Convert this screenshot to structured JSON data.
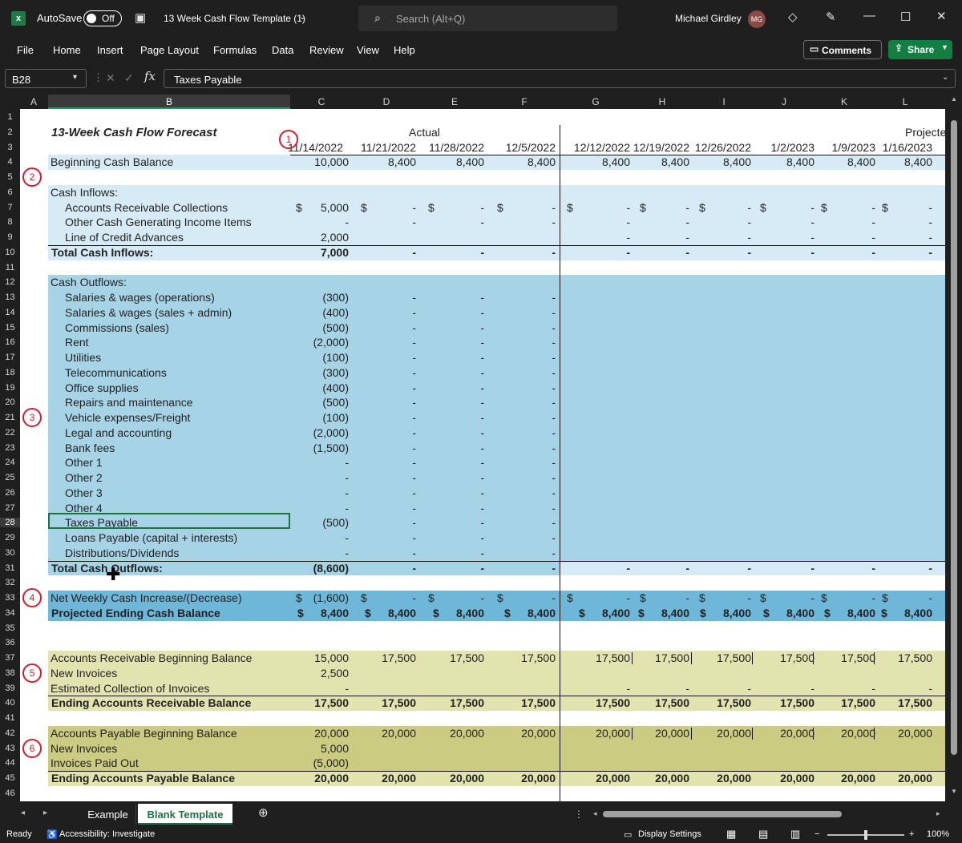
{
  "window": {
    "autosave_label": "AutoSave",
    "autosave_state": "Off",
    "file_title": "13 Week Cash Flow Template (1)",
    "search_placeholder": "Search (Alt+Q)",
    "user_name": "Michael Girdley",
    "user_initials": "MG"
  },
  "ribbon": {
    "menus": [
      "File",
      "Home",
      "Insert",
      "Page Layout",
      "Formulas",
      "Data",
      "Review",
      "View",
      "Help"
    ],
    "comments_label": "Comments",
    "share_label": "Share"
  },
  "formula_bar": {
    "name_box": "B28",
    "formula": "Taxes Payable"
  },
  "columns": [
    "A",
    "B",
    "C",
    "D",
    "E",
    "F",
    "G",
    "H",
    "I",
    "J",
    "K",
    "L"
  ],
  "sheet": {
    "title": "13-Week  Cash Flow Forecast",
    "actual_label": "Actual",
    "projected_label": "Projecte",
    "dates": [
      "11/14/2022",
      "11/21/2022",
      "11/28/2022",
      "12/5/2022",
      "12/12/2022",
      "12/19/2022",
      "12/26/2022",
      "1/2/2023",
      "1/9/2023",
      "1/16/2023"
    ],
    "rows": [
      {
        "row": 4,
        "label": "Beginning Cash Balance",
        "values": [
          "10,000",
          "8,400",
          "8,400",
          "8,400",
          "8,400",
          "8,400",
          "8,400",
          "8,400",
          "8,400",
          "8,400"
        ]
      },
      {
        "row": 6,
        "label": "Cash Inflows:",
        "values": []
      },
      {
        "row": 7,
        "label": "Accounts Receivable Collections",
        "indent": true,
        "values": [
          "5,000",
          "-",
          "-",
          "-",
          "-",
          "-",
          "-",
          "-",
          "-",
          "-"
        ],
        "dollar": true
      },
      {
        "row": 8,
        "label": "Other Cash Generating Income Items",
        "indent": true,
        "values": [
          "-",
          "-",
          "-",
          "-",
          "-",
          "-",
          "-",
          "-",
          "-",
          "-"
        ]
      },
      {
        "row": 9,
        "label": "Line of Credit Advances",
        "indent": true,
        "values": [
          "2,000",
          "",
          "",
          "",
          "-",
          "-",
          "-",
          "-",
          "-",
          "-"
        ]
      },
      {
        "row": 10,
        "label": "Total Cash Inflows:",
        "bold": true,
        "values": [
          "7,000",
          "-",
          "-",
          "-",
          "-",
          "-",
          "-",
          "-",
          "-",
          "-"
        ]
      },
      {
        "row": 12,
        "label": "Cash Outflows:",
        "values": []
      },
      {
        "row": 13,
        "label": "Salaries & wages (operations)",
        "indent": true,
        "values": [
          "(300)",
          "-",
          "-",
          "-"
        ]
      },
      {
        "row": 14,
        "label": "Salaries & wages (sales + admin)",
        "indent": true,
        "values": [
          "(400)",
          "-",
          "-",
          "-"
        ]
      },
      {
        "row": 15,
        "label": "Commissions (sales)",
        "indent": true,
        "values": [
          "(500)",
          "-",
          "-",
          "-"
        ]
      },
      {
        "row": 16,
        "label": "Rent",
        "indent": true,
        "values": [
          "(2,000)",
          "-",
          "-",
          "-"
        ]
      },
      {
        "row": 17,
        "label": "Utilities",
        "indent": true,
        "values": [
          "(100)",
          "-",
          "-",
          "-"
        ]
      },
      {
        "row": 18,
        "label": "Telecommunications",
        "indent": true,
        "values": [
          "(300)",
          "-",
          "-",
          "-"
        ]
      },
      {
        "row": 19,
        "label": "Office supplies",
        "indent": true,
        "values": [
          "(400)",
          "-",
          "-",
          "-"
        ]
      },
      {
        "row": 20,
        "label": "Repairs and maintenance",
        "indent": true,
        "values": [
          "(500)",
          "-",
          "-",
          "-"
        ]
      },
      {
        "row": 21,
        "label": "Vehicle expenses/Freight",
        "indent": true,
        "values": [
          "(100)",
          "-",
          "-",
          "-"
        ]
      },
      {
        "row": 22,
        "label": "Legal and accounting",
        "indent": true,
        "values": [
          "(2,000)",
          "-",
          "-",
          "-"
        ]
      },
      {
        "row": 23,
        "label": "Bank fees",
        "indent": true,
        "values": [
          "(1,500)",
          "-",
          "-",
          "-"
        ]
      },
      {
        "row": 24,
        "label": "Other 1",
        "indent": true,
        "values": [
          "-",
          "-",
          "-",
          "-"
        ]
      },
      {
        "row": 25,
        "label": "Other 2",
        "indent": true,
        "values": [
          "-",
          "-",
          "-",
          "-"
        ]
      },
      {
        "row": 26,
        "label": "Other 3",
        "indent": true,
        "values": [
          "-",
          "-",
          "-",
          "-"
        ]
      },
      {
        "row": 27,
        "label": "Other 4",
        "indent": true,
        "values": [
          "-",
          "-",
          "-",
          "-"
        ]
      },
      {
        "row": 28,
        "label": "Taxes Payable",
        "indent": true,
        "values": [
          "(500)",
          "-",
          "-",
          "-"
        ]
      },
      {
        "row": 29,
        "label": "Loans Payable (capital + interests)",
        "indent": true,
        "values": [
          "-",
          "-",
          "-",
          "-"
        ]
      },
      {
        "row": 30,
        "label": "Distributions/Dividends",
        "indent": true,
        "values": [
          "-",
          "-",
          "-",
          "-"
        ]
      },
      {
        "row": 31,
        "label": "Total Cash Outflows:",
        "bold": true,
        "values": [
          "(8,600)",
          "-",
          "-",
          "-",
          "-",
          "-",
          "-",
          "-",
          "-",
          "-"
        ]
      },
      {
        "row": 33,
        "label": "Net Weekly Cash Increase/(Decrease)",
        "values": [
          "(1,600)",
          "-",
          "-",
          "-",
          "-",
          "-",
          "-",
          "-",
          "-",
          "-"
        ],
        "dollar": true
      },
      {
        "row": 34,
        "label": "Projected Ending Cash Balance",
        "bold": true,
        "values": [
          "8,400",
          "8,400",
          "8,400",
          "8,400",
          "8,400",
          "8,400",
          "8,400",
          "8,400",
          "8,400",
          "8,400"
        ],
        "dollar_inline": true
      },
      {
        "row": 37,
        "label": "Accounts Receivable Beginning Balance",
        "values": [
          "15,000",
          "17,500",
          "17,500",
          "17,500",
          "17,500",
          "17,500",
          "17,500",
          "17,500",
          "17,500",
          "17,500"
        ]
      },
      {
        "row": 38,
        "label": "New Invoices",
        "values": [
          "2,500"
        ]
      },
      {
        "row": 39,
        "label": "Estimated Collection of Invoices",
        "values": [
          "-",
          "",
          "",
          "",
          "-",
          "-",
          "-",
          "-",
          "-",
          "-"
        ]
      },
      {
        "row": 40,
        "label": "Ending Accounts Receivable Balance",
        "bold": true,
        "values": [
          "17,500",
          "17,500",
          "17,500",
          "17,500",
          "17,500",
          "17,500",
          "17,500",
          "17,500",
          "17,500",
          "17,500"
        ]
      },
      {
        "row": 42,
        "label": "Accounts Payable Beginning Balance",
        "values": [
          "20,000",
          "20,000",
          "20,000",
          "20,000",
          "20,000",
          "20,000",
          "20,000",
          "20,000",
          "20,000",
          "20,000"
        ]
      },
      {
        "row": 43,
        "label": "New Invoices",
        "values": [
          "5,000"
        ]
      },
      {
        "row": 44,
        "label": "Invoices Paid Out",
        "values": [
          "(5,000)"
        ]
      },
      {
        "row": 45,
        "label": "Ending Accounts Payable Balance",
        "bold": true,
        "values": [
          "20,000",
          "20,000",
          "20,000",
          "20,000",
          "20,000",
          "20,000",
          "20,000",
          "20,000",
          "20,000",
          "20,000"
        ]
      }
    ],
    "annotations": [
      {
        "label": "1",
        "row": 2
      },
      {
        "label": "2",
        "row": 5
      },
      {
        "label": "3",
        "row": 21
      },
      {
        "label": "4",
        "row": 33
      },
      {
        "label": "5",
        "row": 38
      },
      {
        "label": "6",
        "row": 43
      }
    ]
  },
  "sheet_tabs": {
    "tabs": [
      "Example",
      "Blank Template"
    ],
    "active": "Blank Template"
  },
  "status": {
    "ready": "Ready",
    "accessibility": "Accessibility: Investigate",
    "display_settings": "Display Settings",
    "zoom": "100%"
  },
  "colors": {
    "light_blue": "#d6ebf5",
    "mid_blue": "#a7d3e6",
    "dark_blue": "#6fb7d9",
    "light_olive": "#e2e4b0",
    "dark_olive": "#cccb82",
    "excel_green": "#1e7145",
    "annotation_red": "#cc1f2f"
  }
}
